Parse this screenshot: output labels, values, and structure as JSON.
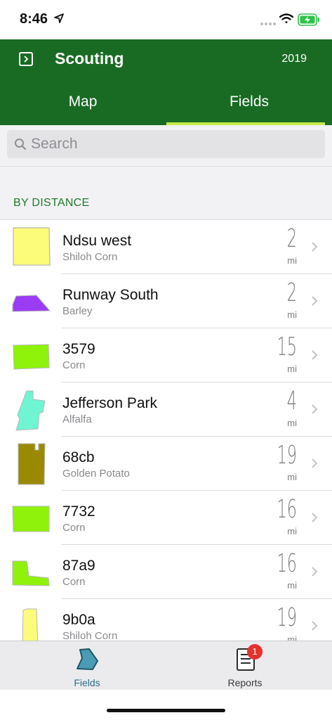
{
  "status": {
    "time": "8:46"
  },
  "header": {
    "title": "Scouting",
    "year": "2019"
  },
  "tabs": [
    {
      "label": "Map"
    },
    {
      "label": "Fields"
    }
  ],
  "search": {
    "placeholder": "Search"
  },
  "section": {
    "title": "BY DISTANCE"
  },
  "fields": [
    {
      "name": "Ndsu west",
      "crop": "Shiloh Corn",
      "distance": "2",
      "unit": "mi",
      "color": "#fdfb7a"
    },
    {
      "name": "Runway South",
      "crop": "Barley",
      "distance": "2",
      "unit": "mi",
      "color": "#9b3cf5"
    },
    {
      "name": "3579",
      "crop": "Corn",
      "distance": "15",
      "unit": "mi",
      "color": "#8ef20a"
    },
    {
      "name": "Jefferson Park",
      "crop": "Alfalfa",
      "distance": "4",
      "unit": "mi",
      "color": "#6ff5d2"
    },
    {
      "name": "68cb",
      "crop": "Golden Potato",
      "distance": "19",
      "unit": "mi",
      "color": "#9a8a02"
    },
    {
      "name": "7732",
      "crop": "Corn",
      "distance": "16",
      "unit": "mi",
      "color": "#8ef20a"
    },
    {
      "name": "87a9",
      "crop": "Corn",
      "distance": "16",
      "unit": "mi",
      "color": "#8ef20a"
    },
    {
      "name": "9b0a",
      "crop": "Shiloh Corn",
      "distance": "19",
      "unit": "mi",
      "color": "#fdfb7a"
    }
  ],
  "tabbar": {
    "fields_label": "Fields",
    "reports_label": "Reports",
    "reports_badge": "1"
  },
  "colors": {
    "header": "#196b23",
    "accent": "#c5e84a",
    "section_text": "#1f7a2c",
    "active_tab": "#2a6f87",
    "badge": "#e5322b"
  },
  "icons": [
    "location-arrow-icon",
    "wifi-icon",
    "battery-charging-icon",
    "sidebar-toggle-icon",
    "search-icon",
    "chevron-right-icon",
    "fields-tab-icon",
    "reports-tab-icon"
  ]
}
